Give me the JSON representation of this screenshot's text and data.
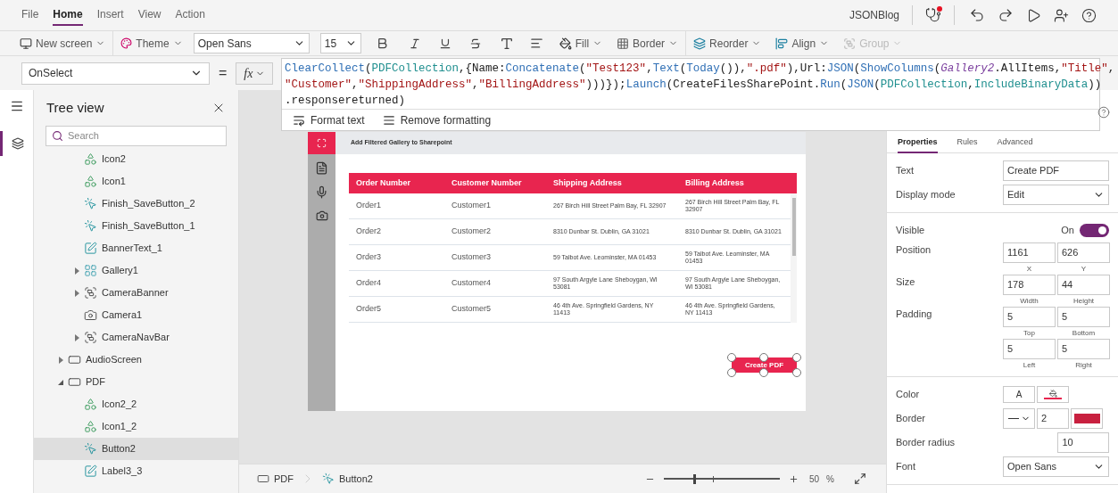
{
  "menu": {
    "tabs": [
      {
        "label": "File",
        "selected": false
      },
      {
        "label": "Home",
        "selected": true
      },
      {
        "label": "Insert",
        "selected": false
      },
      {
        "label": "View",
        "selected": false
      },
      {
        "label": "Action",
        "selected": false
      }
    ],
    "app_name": "JSONBlog"
  },
  "toolbar": {
    "new_screen": "New screen",
    "theme": "Theme",
    "font": "Open Sans",
    "font_size": "15",
    "fill": "Fill",
    "border": "Border",
    "reorder": "Reorder",
    "align": "Align",
    "group": {
      "label": "Group",
      "disabled": true
    }
  },
  "formula_bar": {
    "property": "OnSelect",
    "equals": "=",
    "fx": "fx",
    "lines": [
      [
        {
          "kind": "fn",
          "text": "ClearCollect"
        },
        {
          "kind": "txt",
          "text": "("
        },
        {
          "kind": "coll",
          "text": "PDFCollection"
        },
        {
          "kind": "txt",
          "text": ",{Name:"
        },
        {
          "kind": "fn",
          "text": "Concatenate"
        },
        {
          "kind": "txt",
          "text": "("
        },
        {
          "kind": "str",
          "text": "\"Test123\""
        },
        {
          "kind": "txt",
          "text": ","
        },
        {
          "kind": "fn",
          "text": "Text"
        },
        {
          "kind": "txt",
          "text": "("
        },
        {
          "kind": "fn",
          "text": "Today"
        },
        {
          "kind": "txt",
          "text": "()),"
        },
        {
          "kind": "str",
          "text": "\".pdf\""
        },
        {
          "kind": "txt",
          "text": "),Url:"
        },
        {
          "kind": "fn",
          "text": "JSON"
        },
        {
          "kind": "txt",
          "text": "("
        },
        {
          "kind": "fn",
          "text": "ShowColumns"
        },
        {
          "kind": "txt",
          "text": "("
        },
        {
          "kind": "ctrl",
          "text": "Gallery2"
        },
        {
          "kind": "txt",
          "text": ".AllItems,"
        },
        {
          "kind": "str",
          "text": "\"Title\""
        },
        {
          "kind": "txt",
          "text": ","
        }
      ],
      [
        {
          "kind": "str",
          "text": "\"Customer\""
        },
        {
          "kind": "txt",
          "text": ","
        },
        {
          "kind": "str",
          "text": "\"ShippingAddress\""
        },
        {
          "kind": "txt",
          "text": ","
        },
        {
          "kind": "str",
          "text": "\"BillingAddress\""
        },
        {
          "kind": "txt",
          "text": ")))});"
        },
        {
          "kind": "fn",
          "text": "Launch"
        },
        {
          "kind": "txt",
          "text": "(CreateFilesSharePoint."
        },
        {
          "kind": "fn",
          "text": "Run"
        },
        {
          "kind": "txt",
          "text": "("
        },
        {
          "kind": "fn",
          "text": "JSON"
        },
        {
          "kind": "txt",
          "text": "("
        },
        {
          "kind": "coll",
          "text": "PDFCollection"
        },
        {
          "kind": "txt",
          "text": ","
        },
        {
          "kind": "coll",
          "text": "IncludeBinaryData"
        },
        {
          "kind": "txt",
          "text": "))"
        }
      ],
      [
        {
          "kind": "txt",
          "text": ".responsereturned)"
        }
      ]
    ],
    "format_text": "Format text",
    "remove_formatting": "Remove formatting"
  },
  "tree": {
    "title": "Tree view",
    "search_placeholder": "Search",
    "items": [
      {
        "children": [
          {
            "label": "Icon2",
            "kind": "iconset",
            "selected": false
          },
          {
            "label": "Icon1",
            "kind": "iconset",
            "selected": false
          },
          {
            "label": "Finish_SaveButton_2",
            "kind": "button",
            "selected": false
          },
          {
            "label": "Finish_SaveButton_1",
            "kind": "button",
            "selected": false
          },
          {
            "label": "BannerText_1",
            "kind": "label",
            "selected": false
          },
          {
            "label": "Gallery1",
            "kind": "gallery",
            "expanded": false,
            "selected": false
          },
          {
            "label": "CameraBanner",
            "kind": "group",
            "expanded": false,
            "selected": false
          },
          {
            "label": "Camera1",
            "kind": "camera",
            "selected": false
          },
          {
            "label": "CameraNavBar",
            "kind": "group",
            "expanded": false,
            "selected": false
          }
        ]
      },
      {
        "label": "AudioScreen",
        "kind": "screen",
        "expanded": false,
        "selected": false
      },
      {
        "label": "PDF",
        "kind": "screen",
        "expanded": true,
        "selected": false,
        "children": [
          {
            "label": "Icon2_2",
            "kind": "iconset",
            "selected": false
          },
          {
            "label": "Icon1_2",
            "kind": "iconset",
            "selected": false
          },
          {
            "label": "Button2",
            "kind": "button",
            "selected": true
          },
          {
            "label": "Label3_3",
            "kind": "label",
            "selected": false
          }
        ]
      }
    ]
  },
  "preview": {
    "header": "Add Filtered Gallery to Sharepoint",
    "columns": [
      "Order Number",
      "Customer Number",
      "Shipping Address",
      "Billing Address"
    ],
    "rows": [
      [
        "Order1",
        "Customer1",
        "267 Birch Hill Street Palm Bay, FL 32907",
        "267 Birch Hill Street Palm Bay, FL 32907"
      ],
      [
        "Order2",
        "Customer2",
        "8310 Dunbar St. Dublin, GA 31021",
        "8310 Dunbar St. Dublin, GA 31021"
      ],
      [
        "Order3",
        "Customer3",
        "59 Talbot Ave. Leominster, MA 01453",
        "59 Talbot Ave. Leominster, MA 01453"
      ],
      [
        "Order4",
        "Customer4",
        "97 South Argyle Lane Sheboygan, WI 53081",
        "97 South Argyle Lane Sheboygan, WI 53081"
      ],
      [
        "Order5",
        "Customer5",
        "46 4th Ave. Springfield Gardens, NY 11413",
        "46 4th Ave. Springfield Gardens, NY 11413"
      ]
    ],
    "button": "Create PDF"
  },
  "status_bar": {
    "breadcrumbs": [
      {
        "label": "PDF",
        "kind": "screen"
      },
      {
        "label": "Button2",
        "kind": "button"
      }
    ],
    "zoom": {
      "level": 0.26,
      "value": "50",
      "unit": "%"
    }
  },
  "properties": {
    "tabs": [
      {
        "label": "Properties",
        "selected": true
      },
      {
        "label": "Rules",
        "selected": false
      },
      {
        "label": "Advanced",
        "selected": false
      }
    ],
    "sections": [
      [
        {
          "kind": "text",
          "label": "Text",
          "value": "Create PDF"
        },
        {
          "kind": "select",
          "label": "Display mode",
          "value": "Edit"
        }
      ],
      [
        {
          "kind": "toggle",
          "label": "Visible",
          "state_text": "On",
          "on": true
        },
        {
          "kind": "pair",
          "label": "Position",
          "fields": [
            {
              "value": "1161",
              "caption": "X"
            },
            {
              "value": "626",
              "caption": "Y"
            }
          ]
        },
        {
          "kind": "pair",
          "label": "Size",
          "fields": [
            {
              "value": "178",
              "caption": "Width"
            },
            {
              "value": "44",
              "caption": "Height"
            }
          ]
        },
        {
          "kind": "pair",
          "label": "Padding",
          "fields": [
            {
              "value": "5",
              "caption": "Top"
            },
            {
              "value": "5",
              "caption": "Bottom"
            }
          ]
        },
        {
          "kind": "pair",
          "fields": [
            {
              "value": "5",
              "caption": "Left"
            },
            {
              "value": "5",
              "caption": "Right"
            }
          ]
        }
      ],
      [
        {
          "kind": "color",
          "label": "Color",
          "glyph": "A"
        },
        {
          "kind": "border",
          "label": "Border",
          "value": "2",
          "color": "#c8203f"
        },
        {
          "kind": "number",
          "label": "Border radius",
          "value": "10"
        },
        {
          "kind": "select",
          "label": "Font",
          "value": "Open Sans"
        }
      ]
    ]
  }
}
